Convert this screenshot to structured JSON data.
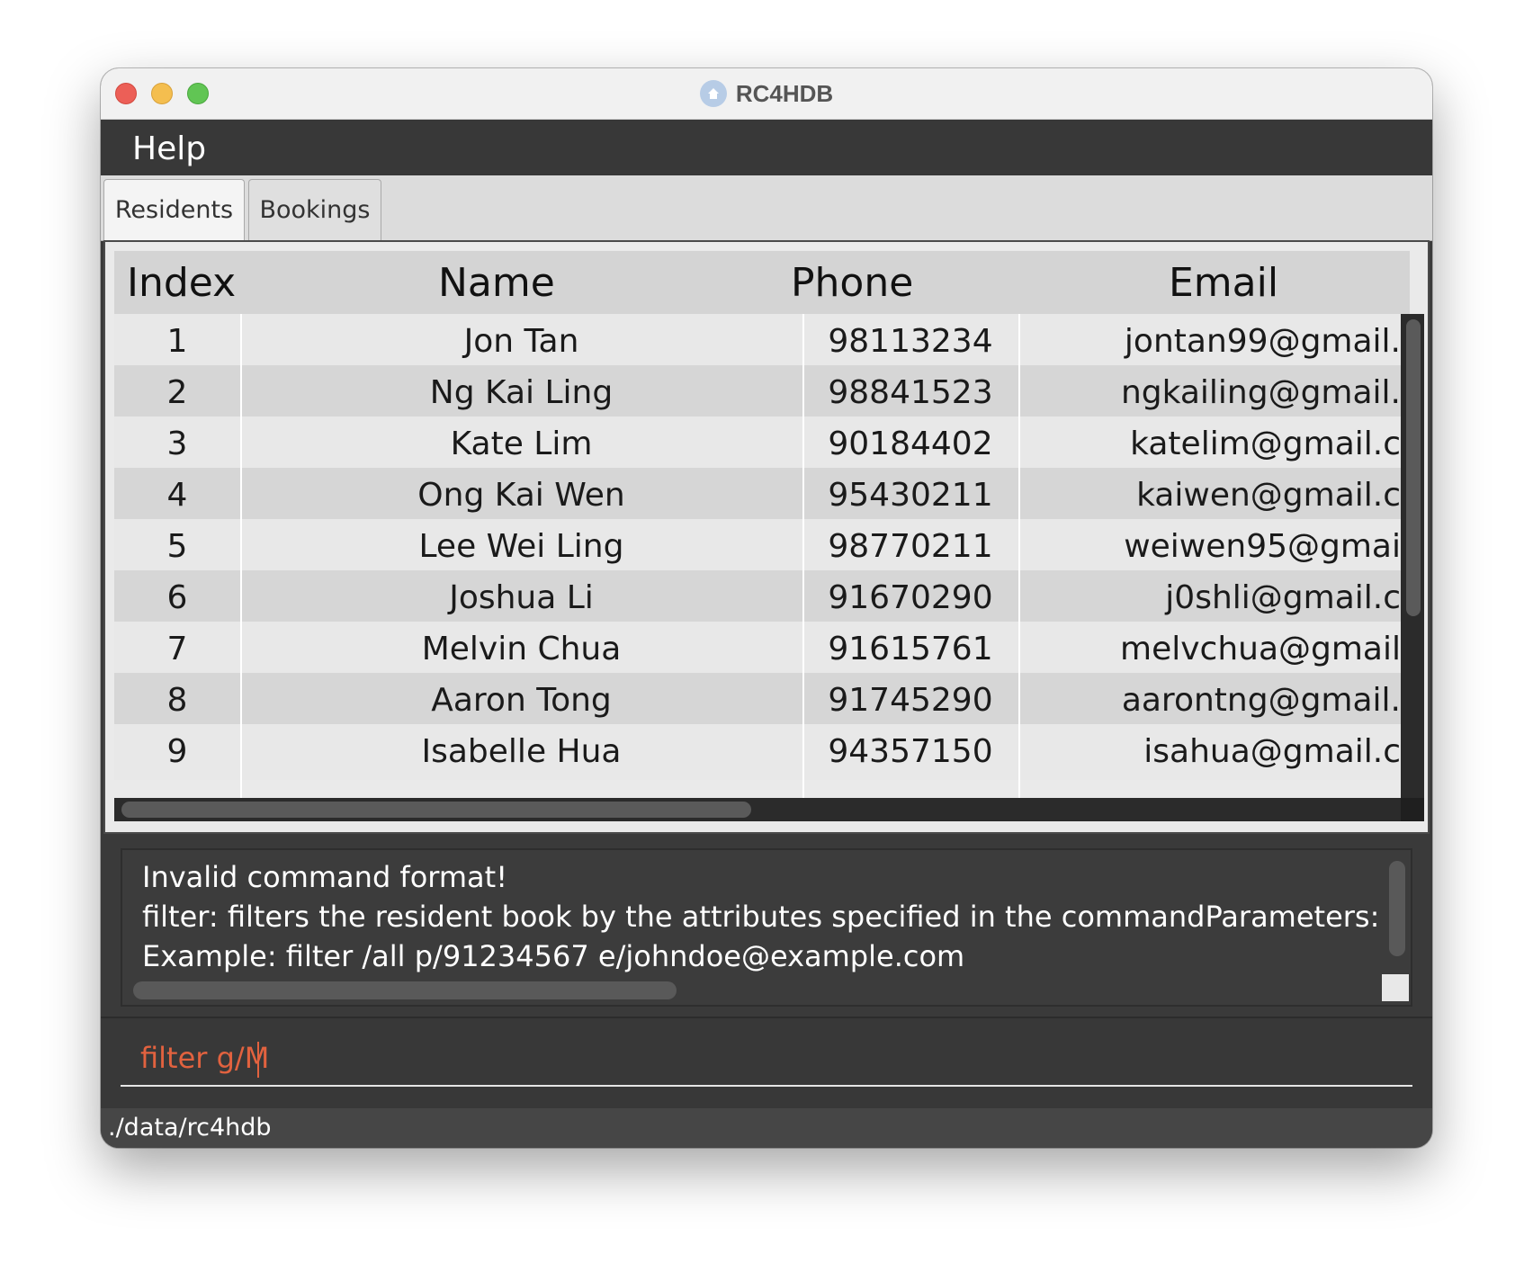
{
  "window": {
    "title": "RC4HDB"
  },
  "menu": {
    "help_label": "Help"
  },
  "tabs": [
    {
      "label": "Residents",
      "selected": true
    },
    {
      "label": "Bookings",
      "selected": false
    }
  ],
  "table": {
    "columns": [
      "Index",
      "Name",
      "Phone",
      "Email"
    ],
    "rows": [
      {
        "index": "1",
        "name": "Jon Tan",
        "phone": "98113234",
        "email": "jontan99@gmail."
      },
      {
        "index": "2",
        "name": "Ng Kai Ling",
        "phone": "98841523",
        "email": "ngkailing@gmail."
      },
      {
        "index": "3",
        "name": "Kate Lim",
        "phone": "90184402",
        "email": "katelim@gmail.c"
      },
      {
        "index": "4",
        "name": "Ong Kai Wen",
        "phone": "95430211",
        "email": "kaiwen@gmail.c"
      },
      {
        "index": "5",
        "name": "Lee Wei Ling",
        "phone": "98770211",
        "email": "weiwen95@gmai"
      },
      {
        "index": "6",
        "name": "Joshua Li",
        "phone": "91670290",
        "email": "j0shli@gmail.c"
      },
      {
        "index": "7",
        "name": "Melvin Chua",
        "phone": "91615761",
        "email": "melvchua@gmail"
      },
      {
        "index": "8",
        "name": "Aaron Tong",
        "phone": "91745290",
        "email": "aarontng@gmail."
      },
      {
        "index": "9",
        "name": "Isabelle Hua",
        "phone": "94357150",
        "email": "isahua@gmail.c"
      }
    ]
  },
  "result": {
    "lines": [
      "Invalid command format!",
      "filter: filters the resident book by the attributes specified in the commandParameters: [Specifier (",
      "Example: filter /all p/91234567 e/johndoe@example.com"
    ]
  },
  "command": {
    "value": "filter g/M"
  },
  "status": {
    "path": "./data/rc4hdb"
  },
  "colors": {
    "command_text": "#e2623f",
    "dark_bg": "#383838"
  }
}
